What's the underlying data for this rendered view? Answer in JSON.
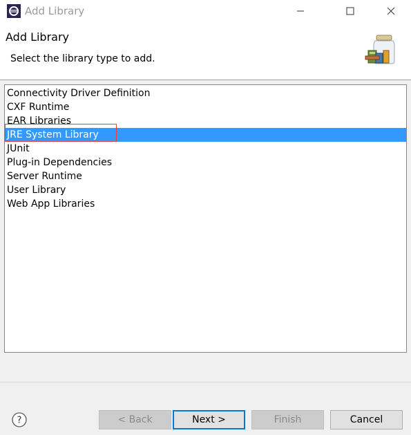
{
  "window": {
    "title": "Add Library"
  },
  "header": {
    "title": "Add Library",
    "description": "Select the library type to add."
  },
  "library_list": {
    "items": [
      "Connectivity Driver Definition",
      "CXF Runtime",
      "EAR Libraries",
      "JRE System Library",
      "JUnit",
      "Plug-in Dependencies",
      "Server Runtime",
      "User Library",
      "Web App Libraries"
    ],
    "selected": "JRE System Library"
  },
  "buttons": {
    "back": "< Back",
    "next": "Next >",
    "finish": "Finish",
    "cancel": "Cancel"
  },
  "icons": {
    "app": "eclipse-icon",
    "header": "library-jar-icon",
    "help": "help-icon",
    "minimize": "minimize-icon",
    "maximize": "maximize-icon",
    "close": "close-icon"
  },
  "colors": {
    "selection": "#3399ff",
    "default_button_border": "#0078d7",
    "highlight_box": "#e04040"
  }
}
